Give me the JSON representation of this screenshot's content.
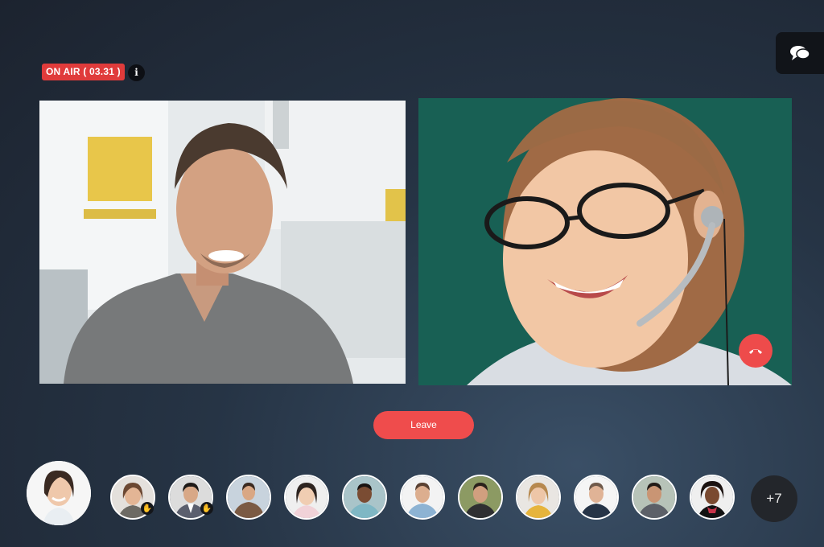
{
  "status": {
    "on_air_label": "ON AIR",
    "timer": "( 03.31 )",
    "info_glyph": "i"
  },
  "controls": {
    "leave_label": "Leave",
    "chat_icon": "chat-bubbles-icon",
    "hangup_icon": "phone-hangup-icon"
  },
  "participants": {
    "more_count": "+7",
    "raised_hand_icon": "raised-hand-icon"
  },
  "colors": {
    "accent_red": "#ef4c4c",
    "on_air_red": "#e03b3b",
    "panel_dark": "#111419"
  }
}
